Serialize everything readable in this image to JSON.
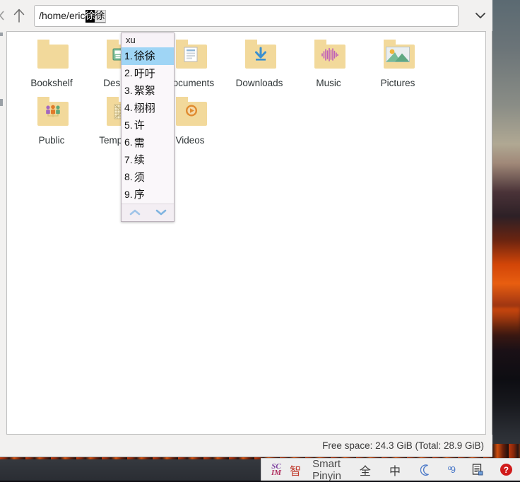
{
  "window": {
    "type": "file-manager",
    "path_value": "/home/eric",
    "preedit_selected": "徐",
    "preedit_rest": "徐",
    "status": "Free space: 24.3 GiB (Total: 28.9 GiB)",
    "nav": {
      "back_icon": "chevron-left-icon",
      "up_icon": "arrow-up-icon",
      "dropdown_icon": "chevron-down-icon"
    }
  },
  "files": [
    {
      "name": "Bookshelf",
      "icon": "folder-plain-icon"
    },
    {
      "name": "Desktop",
      "icon": "folder-desktop-icon"
    },
    {
      "name": "Documents",
      "icon": "folder-documents-icon"
    },
    {
      "name": "Downloads",
      "icon": "folder-downloads-icon"
    },
    {
      "name": "Music",
      "icon": "folder-music-icon"
    },
    {
      "name": "Pictures",
      "icon": "folder-pictures-icon"
    },
    {
      "name": "Public",
      "icon": "folder-public-icon"
    },
    {
      "name": "Templates",
      "icon": "folder-templates-icon"
    },
    {
      "name": "Videos",
      "icon": "folder-videos-icon"
    }
  ],
  "ime_popup": {
    "preedit": "xu",
    "candidates": [
      {
        "num": "1.",
        "text": "徐徐",
        "selected": true
      },
      {
        "num": "2.",
        "text": "吁吁",
        "selected": false
      },
      {
        "num": "3.",
        "text": "絮絮",
        "selected": false
      },
      {
        "num": "4.",
        "text": "栩栩",
        "selected": false
      },
      {
        "num": "5.",
        "text": "许",
        "selected": false
      },
      {
        "num": "6.",
        "text": "需",
        "selected": false
      },
      {
        "num": "7.",
        "text": "续",
        "selected": false
      },
      {
        "num": "8.",
        "text": "须",
        "selected": false
      },
      {
        "num": "9.",
        "text": "序",
        "selected": false
      }
    ],
    "page_up_icon": "chevron-up-icon",
    "page_down_icon": "chevron-down-icon"
  },
  "scim_toolbar": {
    "logo_top": "SC",
    "logo_bottom": "IM",
    "engine_badge": "智",
    "engine_name": "Smart Pinyin",
    "width_mode": "全",
    "language_mode": "中",
    "moon_icon": "moon-icon",
    "punct_icon": "punctuation-icon",
    "punct_glyph": "º9",
    "softkeyboard_icon": "keyboard-doc-icon",
    "help_icon": "help-icon",
    "help_glyph": "?"
  },
  "colors": {
    "selection_blue": "#9fd5f5",
    "folder_yellow": "#f2d99b",
    "window_bg": "#f2f1f0",
    "accent_red": "#d01b1b"
  }
}
